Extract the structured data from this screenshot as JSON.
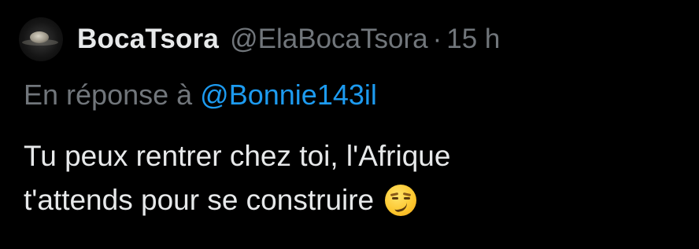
{
  "tweet": {
    "author": {
      "display_name": "BocaTsora",
      "handle": "@ElaBocaTsora",
      "separator": "·",
      "timestamp": "15 h"
    },
    "reply": {
      "prefix": "En réponse à",
      "mention": "@Bonnie143il"
    },
    "text_lines": [
      "Tu peux rentrer chez toi, l'Afrique",
      "t'attends pour se construire"
    ],
    "emoji": "smirking-face-emoji"
  },
  "colors": {
    "background": "#000000",
    "primary_text": "#e7e9ea",
    "secondary_text": "#71767b",
    "mention": "#1d9bf0"
  }
}
